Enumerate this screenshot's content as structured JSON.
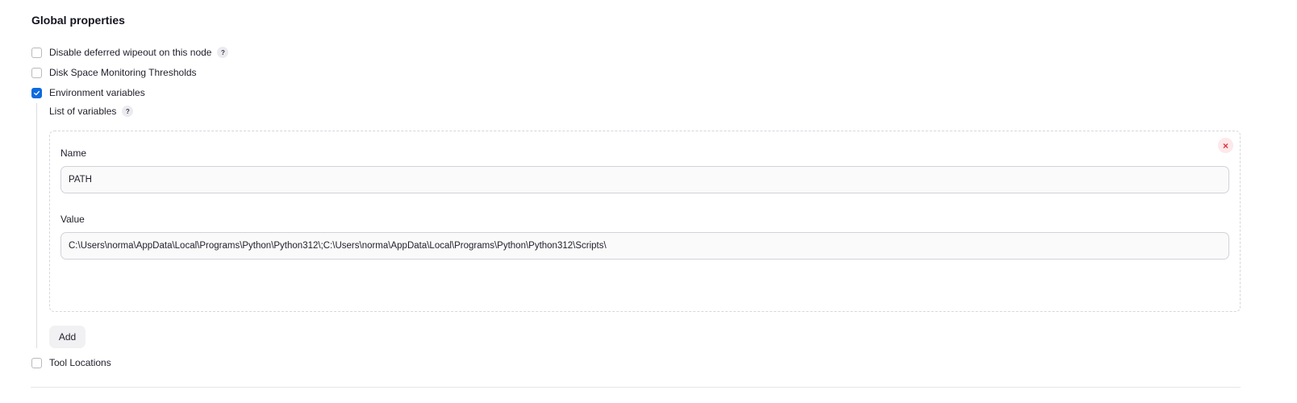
{
  "section": {
    "title": "Global properties"
  },
  "options": {
    "disable_wipeout": {
      "label": "Disable deferred wipeout on this node",
      "checked": false,
      "help": "?"
    },
    "disk_space": {
      "label": "Disk Space Monitoring Thresholds",
      "checked": false
    },
    "env_vars": {
      "label": "Environment variables",
      "checked": true
    },
    "tool_locations": {
      "label": "Tool Locations",
      "checked": false
    }
  },
  "env": {
    "list_label": "List of variables",
    "help": "?",
    "entries": [
      {
        "name_label": "Name",
        "name_value": "PATH",
        "value_label": "Value",
        "value_value": "C:\\Users\\norma\\AppData\\Local\\Programs\\Python\\Python312\\;C:\\Users\\norma\\AppData\\Local\\Programs\\Python\\Python312\\Scripts\\",
        "delete_glyph": "×"
      }
    ],
    "add_label": "Add"
  },
  "colors": {
    "accent": "#0b6ade",
    "danger": "#e0303f",
    "danger_bg": "#fde8ea"
  }
}
